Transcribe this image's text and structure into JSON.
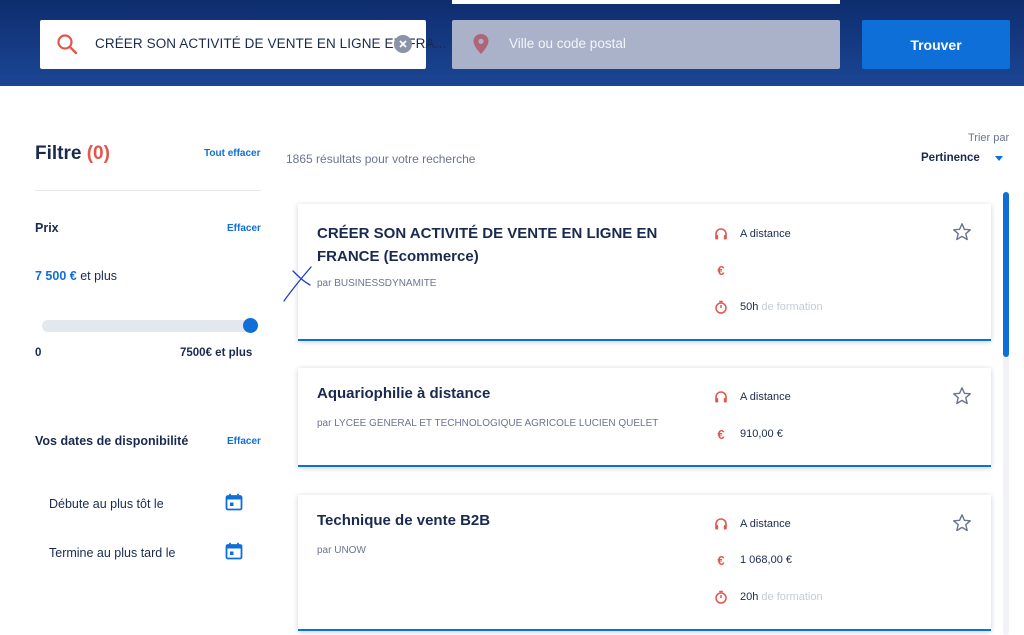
{
  "header": {
    "search_value": "CRÉER SON ACTIVITÉ DE VENTE EN LIGNE EN FRA...",
    "location_placeholder": "Ville ou code postal",
    "find_label": "Trouver"
  },
  "sidebar": {
    "filter_title": "Filtre",
    "filter_count": "(0)",
    "clear_all": "Tout effacer",
    "price": {
      "label": "Prix",
      "clear": "Effacer",
      "value_amount": "7 500 €",
      "value_suffix": " et plus",
      "range_min": "0",
      "range_max": "7500€ et plus",
      "slider_level": 1.0
    },
    "dates": {
      "label": "Vos dates de disponibilité",
      "clear": "Effacer",
      "start_label": "Débute au plus tôt le",
      "end_label": "Termine au plus tard le"
    }
  },
  "results": {
    "count_text": "1865 résultats pour votre recherche",
    "sort_label": "Trier par",
    "sort_value": "Pertinence",
    "cards": [
      {
        "title": "CRÉER SON ACTIVITÉ DE VENTE EN LIGNE EN FRANCE (Ecommerce)",
        "provider": "par BUSINESSDYNAMITE",
        "mode": "A distance",
        "price": "",
        "duration": "50h",
        "duration_suffix": " de formation"
      },
      {
        "title": "Aquariophilie à distance",
        "provider": "par LYCEE GENERAL ET TECHNOLOGIQUE AGRICOLE LUCIEN QUELET",
        "mode": "A distance",
        "price": "910,00 €"
      },
      {
        "title": "Technique de vente B2B",
        "provider": "par UNOW",
        "mode": "A distance",
        "price": "1 068,00 €",
        "duration": "20h",
        "duration_suffix": " de formation"
      }
    ]
  },
  "colors": {
    "header_bg": "#163c85",
    "accent_blue": "#0f6fd9",
    "accent_red": "#e2574c",
    "text_dark": "#1a2a4f"
  },
  "icons": {
    "search": "search-icon",
    "clear": "close-circle-icon",
    "location": "map-pin-icon",
    "headphones": "headphones-icon",
    "euro": "euro-icon",
    "timer": "stopwatch-icon",
    "star": "star-outline-icon",
    "calendar": "calendar-icon"
  }
}
